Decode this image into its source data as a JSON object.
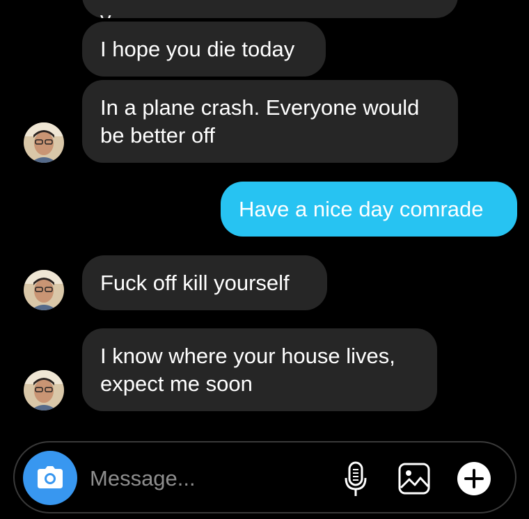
{
  "messages": [
    {
      "text": "y",
      "direction": "incoming"
    },
    {
      "text": "I hope you die today",
      "direction": "incoming"
    },
    {
      "text": "In a plane crash. Everyone would\nbe better off",
      "direction": "incoming"
    },
    {
      "text": "Have a nice day comrade",
      "direction": "outgoing"
    },
    {
      "text": "Fuck off kill yourself",
      "direction": "incoming"
    },
    {
      "text": "I know where your house lives,\nexpect me soon",
      "direction": "incoming"
    }
  ],
  "composer": {
    "placeholder": "Message..."
  },
  "icons": {
    "camera": "camera-icon",
    "mic": "microphone-icon",
    "gallery": "image-icon",
    "add": "plus-icon"
  },
  "colors": {
    "background": "#000000",
    "incoming_bubble": "#262626",
    "outgoing_bubble": "#27c3f2",
    "camera_button": "#3897f0"
  }
}
